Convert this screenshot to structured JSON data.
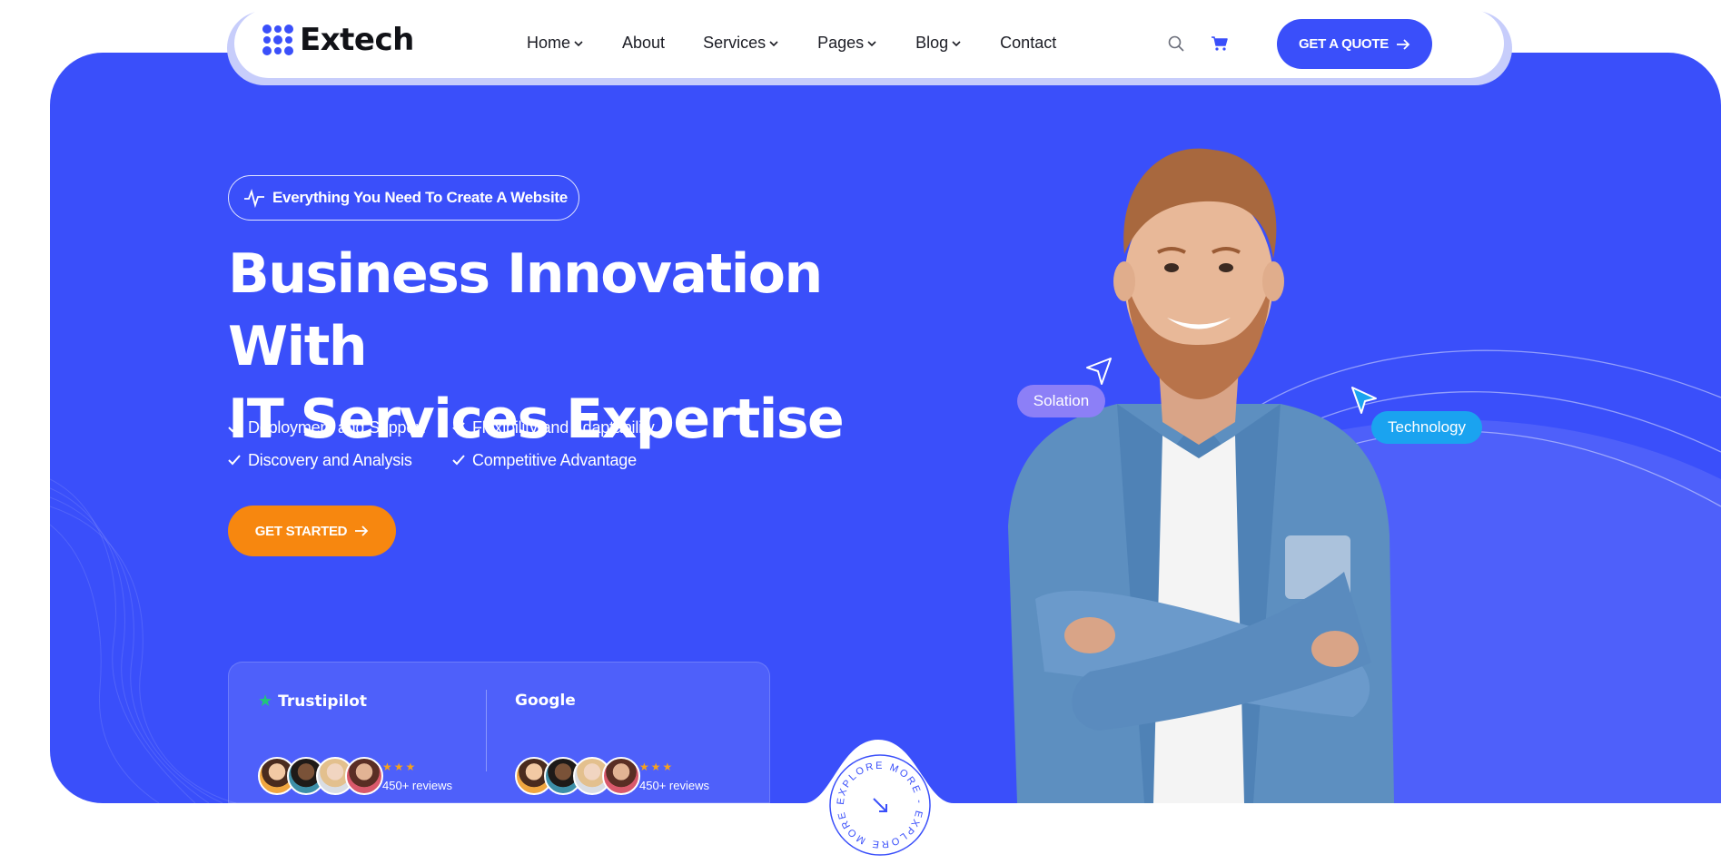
{
  "brand": {
    "name": "Extech",
    "logo_icon": "grid-dots-logo-icon"
  },
  "nav": {
    "items": [
      {
        "label": "Home",
        "has_dropdown": true
      },
      {
        "label": "About",
        "has_dropdown": false
      },
      {
        "label": "Services",
        "has_dropdown": true
      },
      {
        "label": "Pages",
        "has_dropdown": true
      },
      {
        "label": "Blog",
        "has_dropdown": true
      },
      {
        "label": "Contact",
        "has_dropdown": false
      }
    ],
    "search_icon": "search-icon",
    "cart_icon": "cart-icon",
    "cta_label": "GET A QUOTE"
  },
  "hero": {
    "tagline": "Everything You Need To Create A Website",
    "headline_line1": "Business Innovation With",
    "headline_line2": "IT Services Expertise",
    "features": [
      "Deployment and Support",
      "Flexibility and Adaptability",
      "Discovery and Analysis",
      "Competitive Advantage"
    ],
    "cta_label": "GET STARTED"
  },
  "reviews": [
    {
      "platform": "Trustipilot",
      "count_text": "450+ reviews",
      "stars": "★★★"
    },
    {
      "platform": "Google",
      "count_text": "450+ reviews",
      "stars": "★★★"
    }
  ],
  "explore": {
    "ring_text": "EXPLORE MORE - EXPLORE MORE - "
  },
  "floating_tags": {
    "left": "Solation",
    "right": "Technology"
  },
  "colors": {
    "primary": "#3a4ffa",
    "accent_orange": "#f7870f",
    "tag_purple": "#8c7ff7",
    "tag_blue": "#1aa3f0",
    "star": "#f7a21b"
  }
}
